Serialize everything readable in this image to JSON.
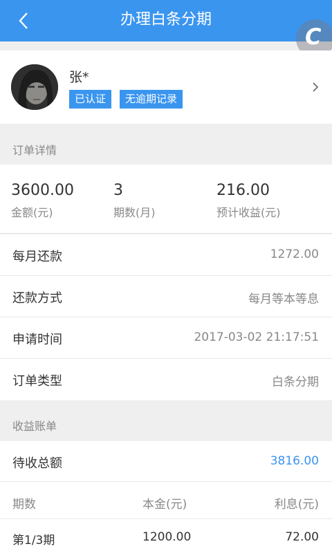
{
  "header": {
    "title": "办理白条分期"
  },
  "profile": {
    "name": "张*",
    "badges": [
      "已认证",
      "无逾期记录"
    ]
  },
  "sections": {
    "order_detail": "订单详情",
    "income_bill": "收益账单"
  },
  "summary": [
    {
      "value": "3600.00",
      "label": "金额(元)"
    },
    {
      "value": "3",
      "label": "期数(月)"
    },
    {
      "value": "216.00",
      "label": "预计收益(元)"
    }
  ],
  "details": [
    {
      "key": "每月还款",
      "value": "1272.00"
    },
    {
      "key": "还款方式",
      "value": "每月等本等息"
    },
    {
      "key": "申请时间",
      "value": "2017-03-02 21:17:51"
    },
    {
      "key": "订单类型",
      "value": "白条分期"
    }
  ],
  "income": {
    "total_label": "待收总额",
    "total_value": "3816.00",
    "columns": [
      "期数",
      "本金(元)",
      "利息(元)"
    ],
    "rows": [
      [
        "第1/3期",
        "1200.00",
        "72.00"
      ]
    ]
  },
  "colors": {
    "accent": "#3a95ef"
  }
}
